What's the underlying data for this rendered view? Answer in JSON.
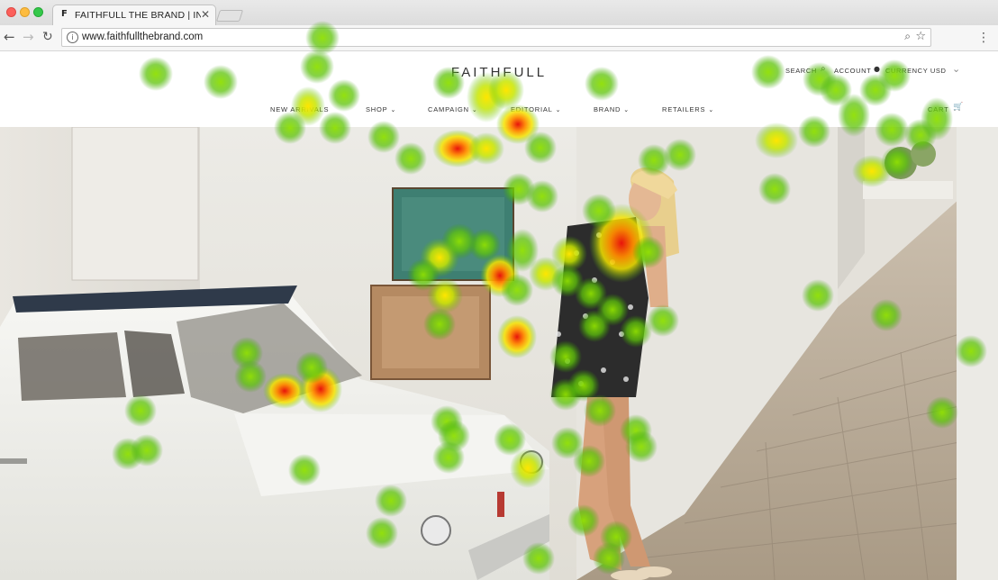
{
  "browser": {
    "tab": {
      "favicon": "F",
      "title": "FAITHFULL THE BRAND | INTE",
      "close": "✕"
    },
    "url": "www.faithfullthebrand.com",
    "icons": [
      "back-arrow-icon",
      "forward-arrow-icon",
      "reload-icon",
      "info-icon",
      "zoom-icon",
      "star-icon",
      "menu-dots-icon"
    ]
  },
  "header": {
    "logo": "FAITHFULL",
    "utility": {
      "search": "SEARCH",
      "account": "ACCOUNT",
      "currency": "CURRENCY USD"
    },
    "nav": [
      {
        "label": "NEW ARRIVALS",
        "has_menu": false
      },
      {
        "label": "SHOP",
        "has_menu": true
      },
      {
        "label": "CAMPAIGN",
        "has_menu": true
      },
      {
        "label": "EDITORIAL",
        "has_menu": true
      },
      {
        "label": "BRAND",
        "has_menu": true
      },
      {
        "label": "RETAILERS",
        "has_menu": true
      }
    ],
    "cart": "CART"
  },
  "hero": {
    "description_hidden": true
  },
  "colors": {
    "heat_low": "#7ed321",
    "heat_mid": "#f5e400",
    "heat_high": "#e8130b"
  }
}
